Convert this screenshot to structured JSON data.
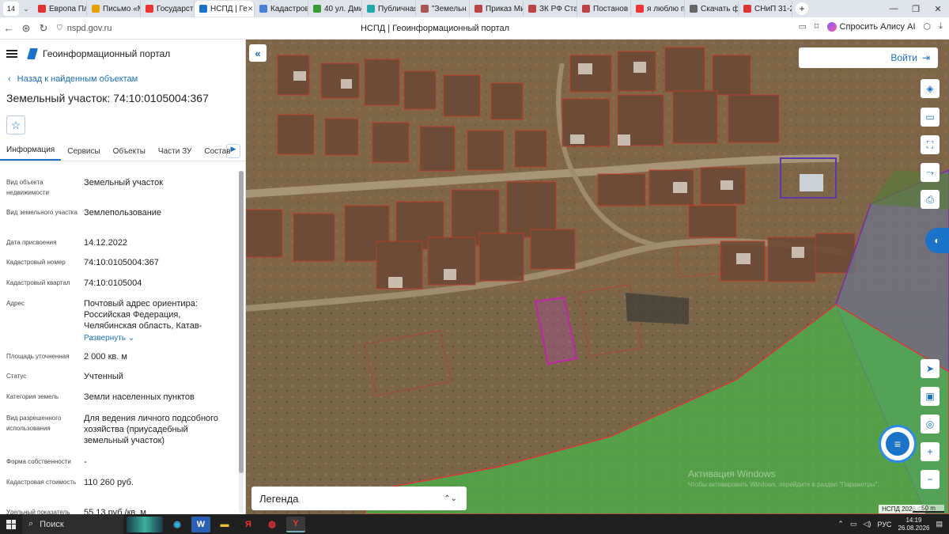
{
  "browser": {
    "tab_count": "14",
    "tabs": [
      {
        "label": "Европа Пл",
        "color": "#d33"
      },
      {
        "label": "Письмо «М",
        "color": "#e8a000"
      },
      {
        "label": "Государст",
        "color": "#e33"
      },
      {
        "label": "НСПД | Ге",
        "color": "#1a73c9",
        "active": true
      },
      {
        "label": "Кадастров",
        "color": "#4a7fd6"
      },
      {
        "label": "40 ул. Дми",
        "color": "#3a9a3a"
      },
      {
        "label": "Публичная",
        "color": "#2aa"
      },
      {
        "label": "\"Земельн",
        "color": "#a55"
      },
      {
        "label": "Приказ Ми",
        "color": "#b44"
      },
      {
        "label": "ЗК РФ Ста",
        "color": "#b44"
      },
      {
        "label": "Постанов",
        "color": "#b44"
      },
      {
        "label": "я люблю п",
        "color": "#e33"
      },
      {
        "label": "Скачать ф",
        "color": "#666"
      },
      {
        "label": "СНиП 31-2",
        "color": "#d33"
      }
    ],
    "url": "nspd.gov.ru",
    "page_title": "НСПД | Геоинформационный портал",
    "ask_alisa": "Спросить Алису AI"
  },
  "panel": {
    "app_title": "Геоинформационный портал",
    "back_link": "Назад к найденным объектам",
    "object_title": "Земельный участок: 74:10:0105004:367",
    "tabs": [
      "Информация",
      "Сервисы",
      "Объекты",
      "Части ЗУ",
      "Состав"
    ],
    "props": [
      {
        "label": "Вид объекта недвижимости",
        "value": "Земельный участок"
      },
      {
        "label": "Вид земельного участка",
        "value": "Землепользование"
      },
      {
        "label": "Дата присвоения",
        "value": "14.12.2022"
      },
      {
        "label": "Кадастровый номер",
        "value": "74:10:0105004:367"
      },
      {
        "label": "Кадастровый квартал",
        "value": "74:10:0105004"
      },
      {
        "label": "Адрес",
        "value": "Почтовый адрес ориентира: Российская Федерация, Челябинская область, Катав-"
      },
      {
        "label": "Площадь уточненная",
        "value": "2 000 кв. м"
      },
      {
        "label": "Статус",
        "value": "Учтенный"
      },
      {
        "label": "Категория земель",
        "value": "Земли населенных пунктов"
      },
      {
        "label": "Вид разрешенного использования",
        "value": "Для ведения личного подсобного хозяйства (приусадебный земельный участок)"
      },
      {
        "label": "Форма собственности",
        "value": "-"
      },
      {
        "label": "Кадастровая стоимость",
        "value": "110 260 руб."
      },
      {
        "label": "Удельный показатель",
        "value": "55,13 руб./кв. м"
      }
    ],
    "expand_label": "Развернуть"
  },
  "map": {
    "login": "Войти",
    "legend": "Легенда",
    "watermark_title": "Активация Windows",
    "watermark_sub": "Чтобы активировать Windows, перейдите в раздел \"Параметры\".",
    "copyright": "НСПД 2026 ©",
    "scale": "50 m"
  },
  "taskbar": {
    "search": "Поиск",
    "lang": "РУС",
    "time": "14:19",
    "date": "26.08.2026"
  }
}
